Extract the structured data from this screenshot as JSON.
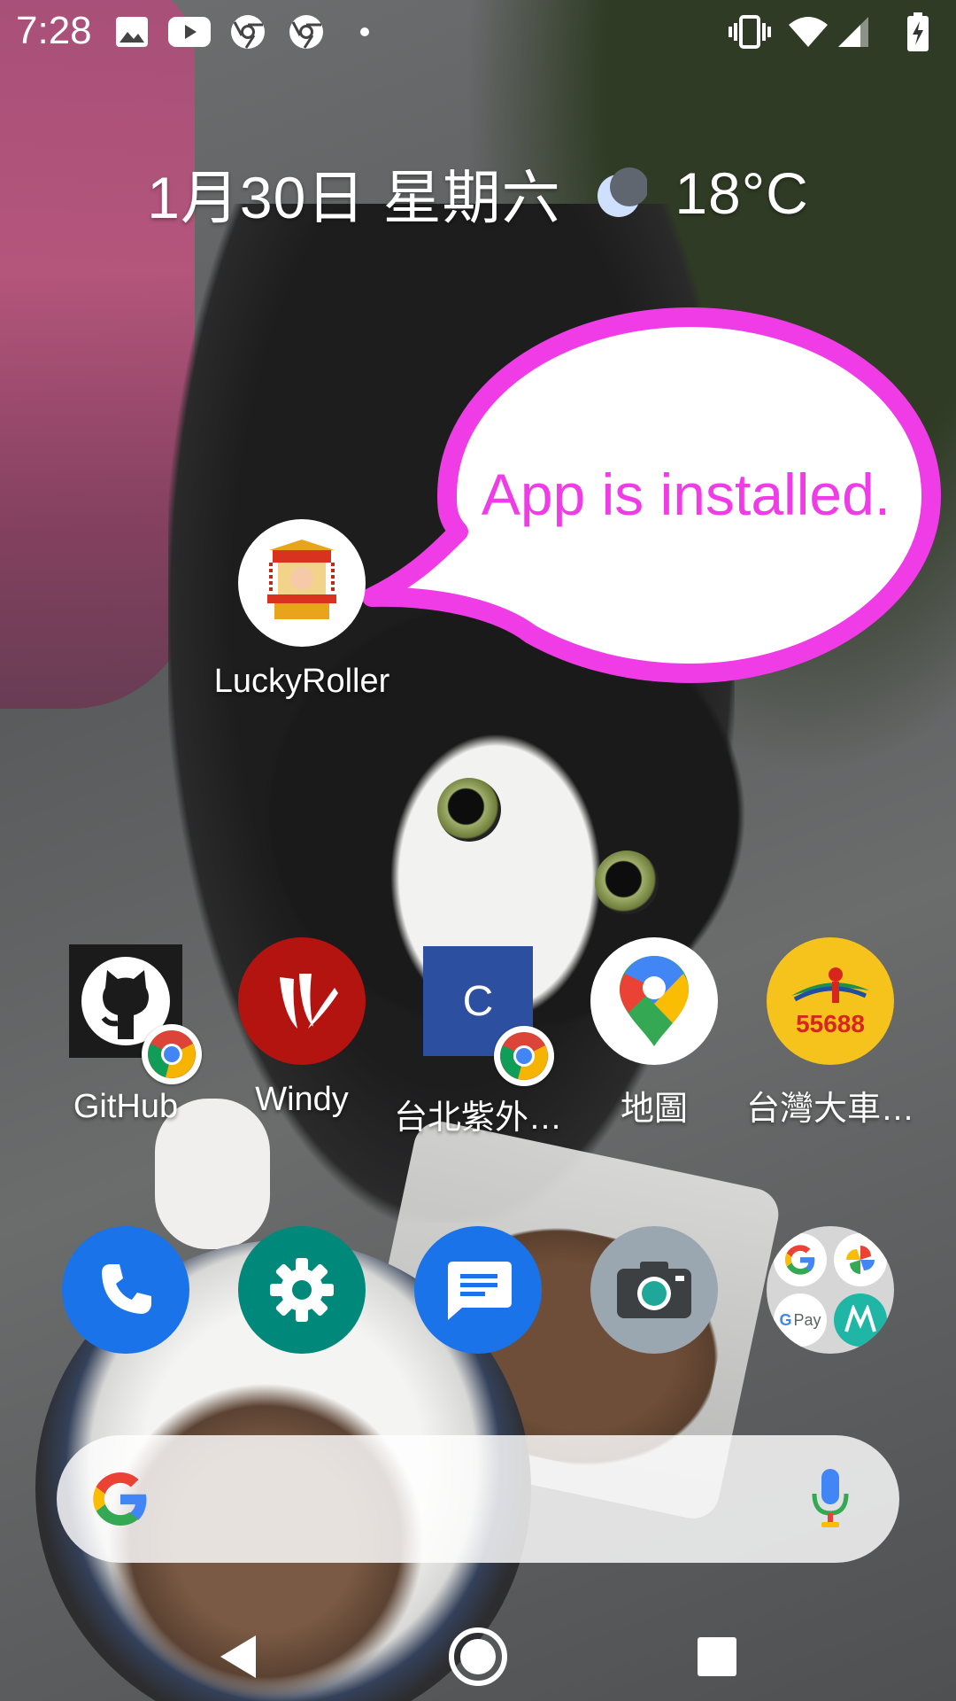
{
  "status_bar": {
    "time": "7:28",
    "notification_icons": [
      "image-icon",
      "youtube-icon",
      "chrome-icon",
      "chrome-icon",
      "more-dot-icon"
    ],
    "system_icons": [
      "vibrate-icon",
      "wifi-icon",
      "signal-icon",
      "battery-charging-icon"
    ]
  },
  "glance": {
    "date": "1月30日 星期六",
    "weather_icon": "moon-icon",
    "temperature": "18°C"
  },
  "callout": {
    "text": "App is installed.",
    "color": "#f03ce6"
  },
  "installed_app": {
    "label": "LuckyRoller",
    "icon": "lucky-roller-icon"
  },
  "app_row": [
    {
      "label": "GitHub",
      "icon": "github-icon",
      "badge": "chrome-icon"
    },
    {
      "label": "Windy",
      "icon": "windy-icon"
    },
    {
      "label": "台北紫外…",
      "icon": "letter-c-icon",
      "badge": "chrome-icon"
    },
    {
      "label": "地圖",
      "icon": "google-maps-icon"
    },
    {
      "label": "台灣大車…",
      "icon": "taxi-55688-icon",
      "icon_text": "55688"
    }
  ],
  "dock": [
    {
      "name": "phone",
      "icon": "phone-icon",
      "color": "#1a73e8"
    },
    {
      "name": "settings",
      "icon": "settings-icon",
      "color": "#00897b"
    },
    {
      "name": "messages",
      "icon": "messages-icon",
      "color": "#1a73e8"
    },
    {
      "name": "camera",
      "icon": "camera-icon",
      "color": "#9aa7b0"
    },
    {
      "name": "google-folder",
      "icon": "google-folder-icon",
      "folder_text": "Pay"
    }
  ],
  "search": {
    "logo": "google-g-icon",
    "mic": "microphone-icon"
  },
  "nav": {
    "back": "back-icon",
    "home": "home-icon",
    "recents": "recents-icon"
  }
}
